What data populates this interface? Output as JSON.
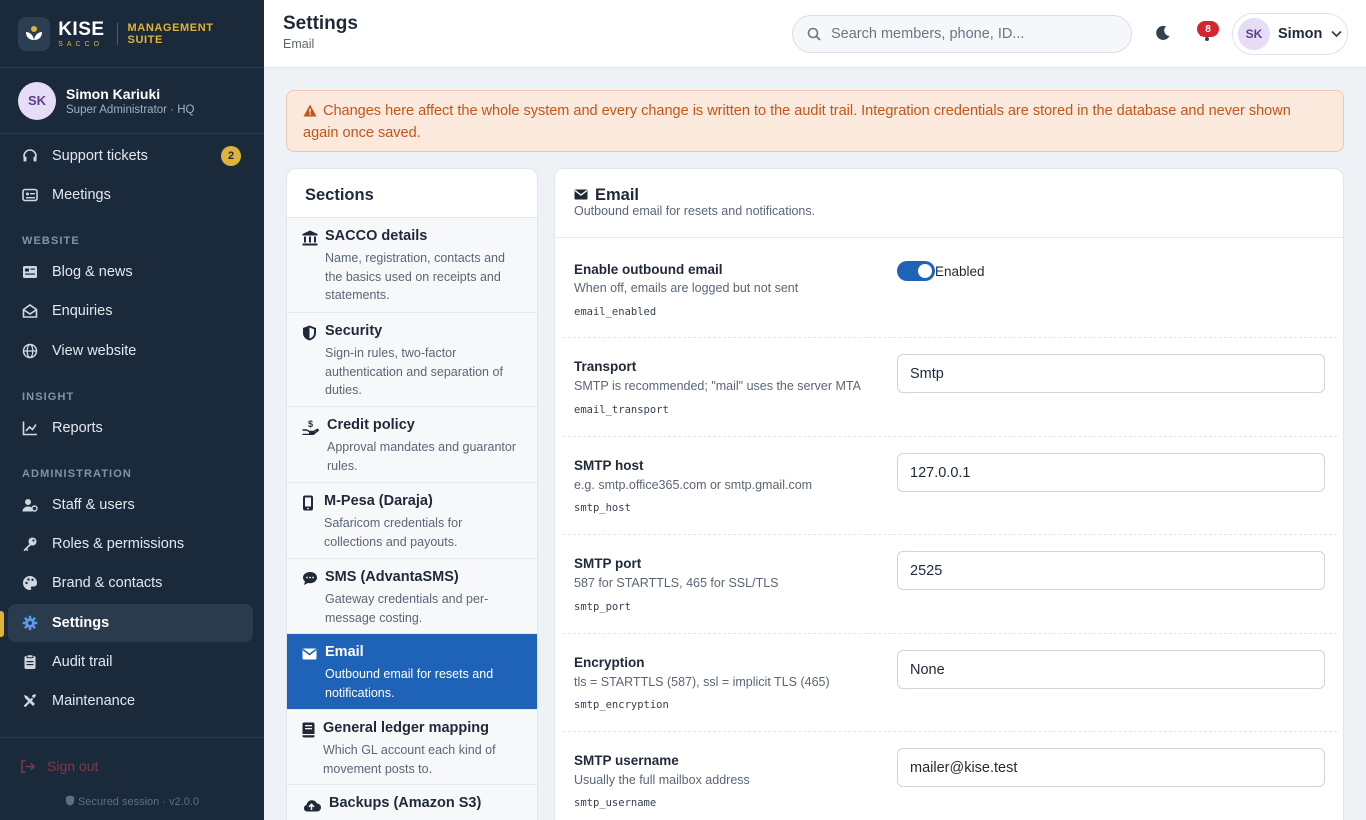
{
  "brand": {
    "name": "KISE",
    "tag": "SACCO",
    "suite": "MANAGEMENT SUITE"
  },
  "user": {
    "initials": "SK",
    "name": "Simon Kariuki",
    "role": "Super Administrator · HQ"
  },
  "nav": {
    "support": "Support tickets",
    "support_badge": "2",
    "meetings": "Meetings",
    "heading_website": "WEBSITE",
    "blog": "Blog & news",
    "enquiries": "Enquiries",
    "view_website": "View website",
    "heading_insight": "INSIGHT",
    "reports": "Reports",
    "heading_admin": "ADMINISTRATION",
    "staff": "Staff & users",
    "roles": "Roles & permissions",
    "brand_contacts": "Brand & contacts",
    "settings": "Settings",
    "audit": "Audit trail",
    "maintenance": "Maintenance",
    "signout": "Sign out",
    "session": "Secured session · v2.0.0"
  },
  "topbar": {
    "title": "Settings",
    "subtitle": "Email",
    "search_placeholder": "Search members, phone, ID...",
    "notif_count": "8",
    "user_initials": "SK",
    "user_short": "Simon"
  },
  "alert": "Changes here affect the whole system and every change is written to the audit trail. Integration credentials are stored in the database and never shown again once saved.",
  "sections": {
    "title": "Sections",
    "items": [
      {
        "title": "SACCO details",
        "desc": "Name, registration, contacts and the basics used on receipts and statements."
      },
      {
        "title": "Security",
        "desc": "Sign-in rules, two-factor authentication and separation of duties."
      },
      {
        "title": "Credit policy",
        "desc": "Approval mandates and guarantor rules."
      },
      {
        "title": "M-Pesa (Daraja)",
        "desc": "Safaricom credentials for collections and payouts."
      },
      {
        "title": "SMS (AdvantaSMS)",
        "desc": "Gateway credentials and per-message costing."
      },
      {
        "title": "Email",
        "desc": "Outbound email for resets and notifications."
      },
      {
        "title": "General ledger mapping",
        "desc": "Which GL account each kind of movement posts to."
      },
      {
        "title": "Backups (Amazon S3)",
        "desc": ""
      }
    ]
  },
  "detail": {
    "title": "Email",
    "subtitle": "Outbound email for resets and notifications.",
    "rows": [
      {
        "label": "Enable outbound email",
        "hint": "When off, emails are logged but not sent",
        "key": "email_enabled",
        "value": "Enabled"
      },
      {
        "label": "Transport",
        "hint": "SMTP is recommended; \"mail\" uses the server MTA",
        "key": "email_transport",
        "value": "Smtp"
      },
      {
        "label": "SMTP host",
        "hint": "e.g. smtp.office365.com or smtp.gmail.com",
        "key": "smtp_host",
        "value": "127.0.0.1"
      },
      {
        "label": "SMTP port",
        "hint": "587 for STARTTLS, 465 for SSL/TLS",
        "key": "smtp_port",
        "value": "2525"
      },
      {
        "label": "Encryption",
        "hint": "tls = STARTTLS (587), ssl = implicit TLS (465)",
        "key": "smtp_encryption",
        "value": "None"
      },
      {
        "label": "SMTP username",
        "hint": "Usually the full mailbox address",
        "key": "smtp_username",
        "value": "mailer@kise.test"
      }
    ]
  },
  "colors": {
    "sidebar": "#1b2a3b",
    "accent": "#e0b23a",
    "primary": "#1e63b8",
    "danger": "#d3262f"
  }
}
